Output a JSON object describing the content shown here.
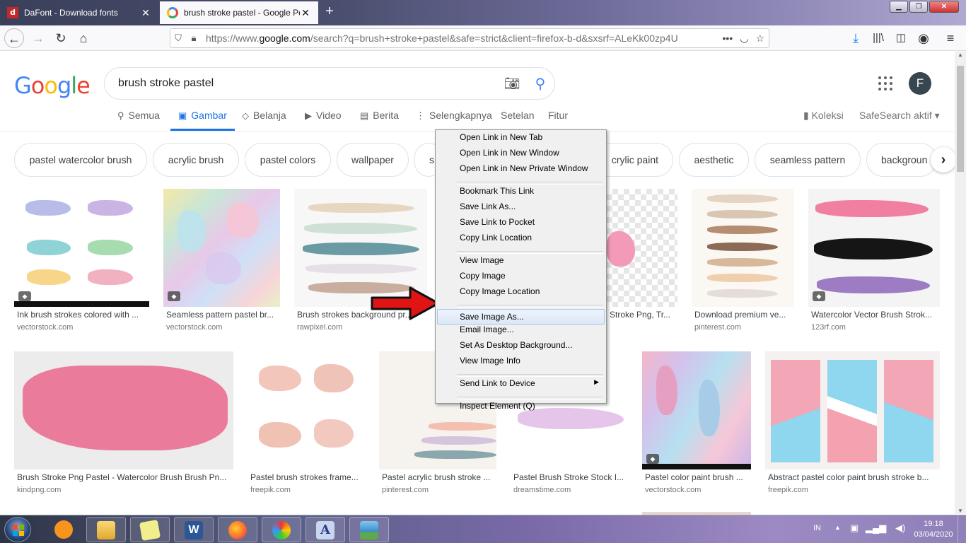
{
  "browser": {
    "tabs": [
      {
        "title": "DaFont - Download fonts",
        "favicon": "dafont-icon",
        "fav_text": "d",
        "active": false
      },
      {
        "title": "brush stroke pastel - Google Penelusuran",
        "favicon": "google-icon",
        "active": true
      }
    ],
    "url_prefix": "https://www.",
    "url_domain": "google.com",
    "url_rest": "/search?q=brush+stroke+pastel&safe=strict&client=firefox-b-d&sxsrf=ALeKk00zp4U",
    "icons": [
      "back-icon",
      "forward-icon",
      "reload-icon",
      "home-icon",
      "shield-icon",
      "lock-icon",
      "more-icon",
      "pocket-icon",
      "bookmark-star-icon",
      "download-icon",
      "library-icon",
      "sidebar-icon",
      "account-icon",
      "menu-icon"
    ]
  },
  "google": {
    "logo_letters": [
      "G",
      "o",
      "o",
      "g",
      "l",
      "e"
    ],
    "logo_colors": [
      "#4285f4",
      "#ea4335",
      "#fbbc05",
      "#4285f4",
      "#34a853",
      "#ea4335"
    ],
    "query": "brush stroke pastel",
    "avatar_initial": "F",
    "tabs": [
      {
        "label": "Semua",
        "icon": "search-icon",
        "glyph": "⚲"
      },
      {
        "label": "Gambar",
        "icon": "image-icon",
        "glyph": "▣",
        "active": true
      },
      {
        "label": "Belanja",
        "icon": "tag-icon",
        "glyph": "◇"
      },
      {
        "label": "Video",
        "icon": "play-icon",
        "glyph": "▶"
      },
      {
        "label": "Berita",
        "icon": "news-icon",
        "glyph": "▤"
      },
      {
        "label": "Selengkapnya",
        "icon": "more-vert-icon",
        "glyph": "⋮"
      },
      {
        "label": "Setelan"
      },
      {
        "label": "Fitur"
      }
    ],
    "koleksi": "Koleksi",
    "safesearch": "SafeSearch aktif"
  },
  "chips": [
    "pastel watercolor brush",
    "acrylic brush",
    "pastel colors",
    "wallpaper",
    "s",
    "crylic paint",
    "aesthetic",
    "seamless pattern",
    "backgroun"
  ],
  "results_row1": [
    {
      "caption": "Ink brush strokes colored with ...",
      "source": "vectorstock.com"
    },
    {
      "caption": "Seamless pattern pastel br...",
      "source": "vectorstock.com"
    },
    {
      "caption": "Brush strokes background pr...",
      "source": "rawpixel.com"
    },
    {
      "caption": "",
      "source": ""
    },
    {
      "caption": "Stroke Png, Tr...",
      "source": ""
    },
    {
      "caption": "Download premium ve...",
      "source": "pinterest.com"
    },
    {
      "caption": "Watercolor Vector Brush Strok...",
      "source": "123rf.com"
    }
  ],
  "results_row2": [
    {
      "caption": "Brush Stroke Png Pastel - Watercolor Brush Brush Pn...",
      "source": "kindpng.com"
    },
    {
      "caption": "Pastel brush strokes frame...",
      "source": "freepik.com"
    },
    {
      "caption": "Pastel acrylic brush stroke ...",
      "source": "pinterest.com"
    },
    {
      "caption": "Pastel Brush Stroke Stock I...",
      "source": "dreamstime.com"
    },
    {
      "caption": "Pastel color paint brush ...",
      "source": "vectorstock.com"
    },
    {
      "caption": "Abstract pastel color paint brush stroke b...",
      "source": "freepik.com"
    }
  ],
  "context_menu": {
    "groups": [
      [
        "Open Link in New Tab",
        "Open Link in New Window",
        "Open Link in New Private Window"
      ],
      [
        "Bookmark This Link",
        "Save Link As...",
        "Save Link to Pocket",
        "Copy Link Location"
      ],
      [
        "View Image",
        "Copy Image",
        "Copy Image Location"
      ],
      [
        "Save Image As...",
        "Email Image...",
        "Set As Desktop Background...",
        "View Image Info"
      ],
      [
        "Send Link to Device"
      ],
      [
        "Inspect Element (Q)"
      ]
    ],
    "highlighted": "Save Image As..."
  },
  "taskbar": {
    "apps": [
      "uc-browser-icon",
      "file-explorer-icon",
      "sticky-notes-icon",
      "word-icon",
      "firefox-icon",
      "paint-icon",
      "font-viewer-icon",
      "photo-viewer-icon"
    ],
    "tray_lang": "IN",
    "time": "19:18",
    "date": "03/04/2020"
  }
}
